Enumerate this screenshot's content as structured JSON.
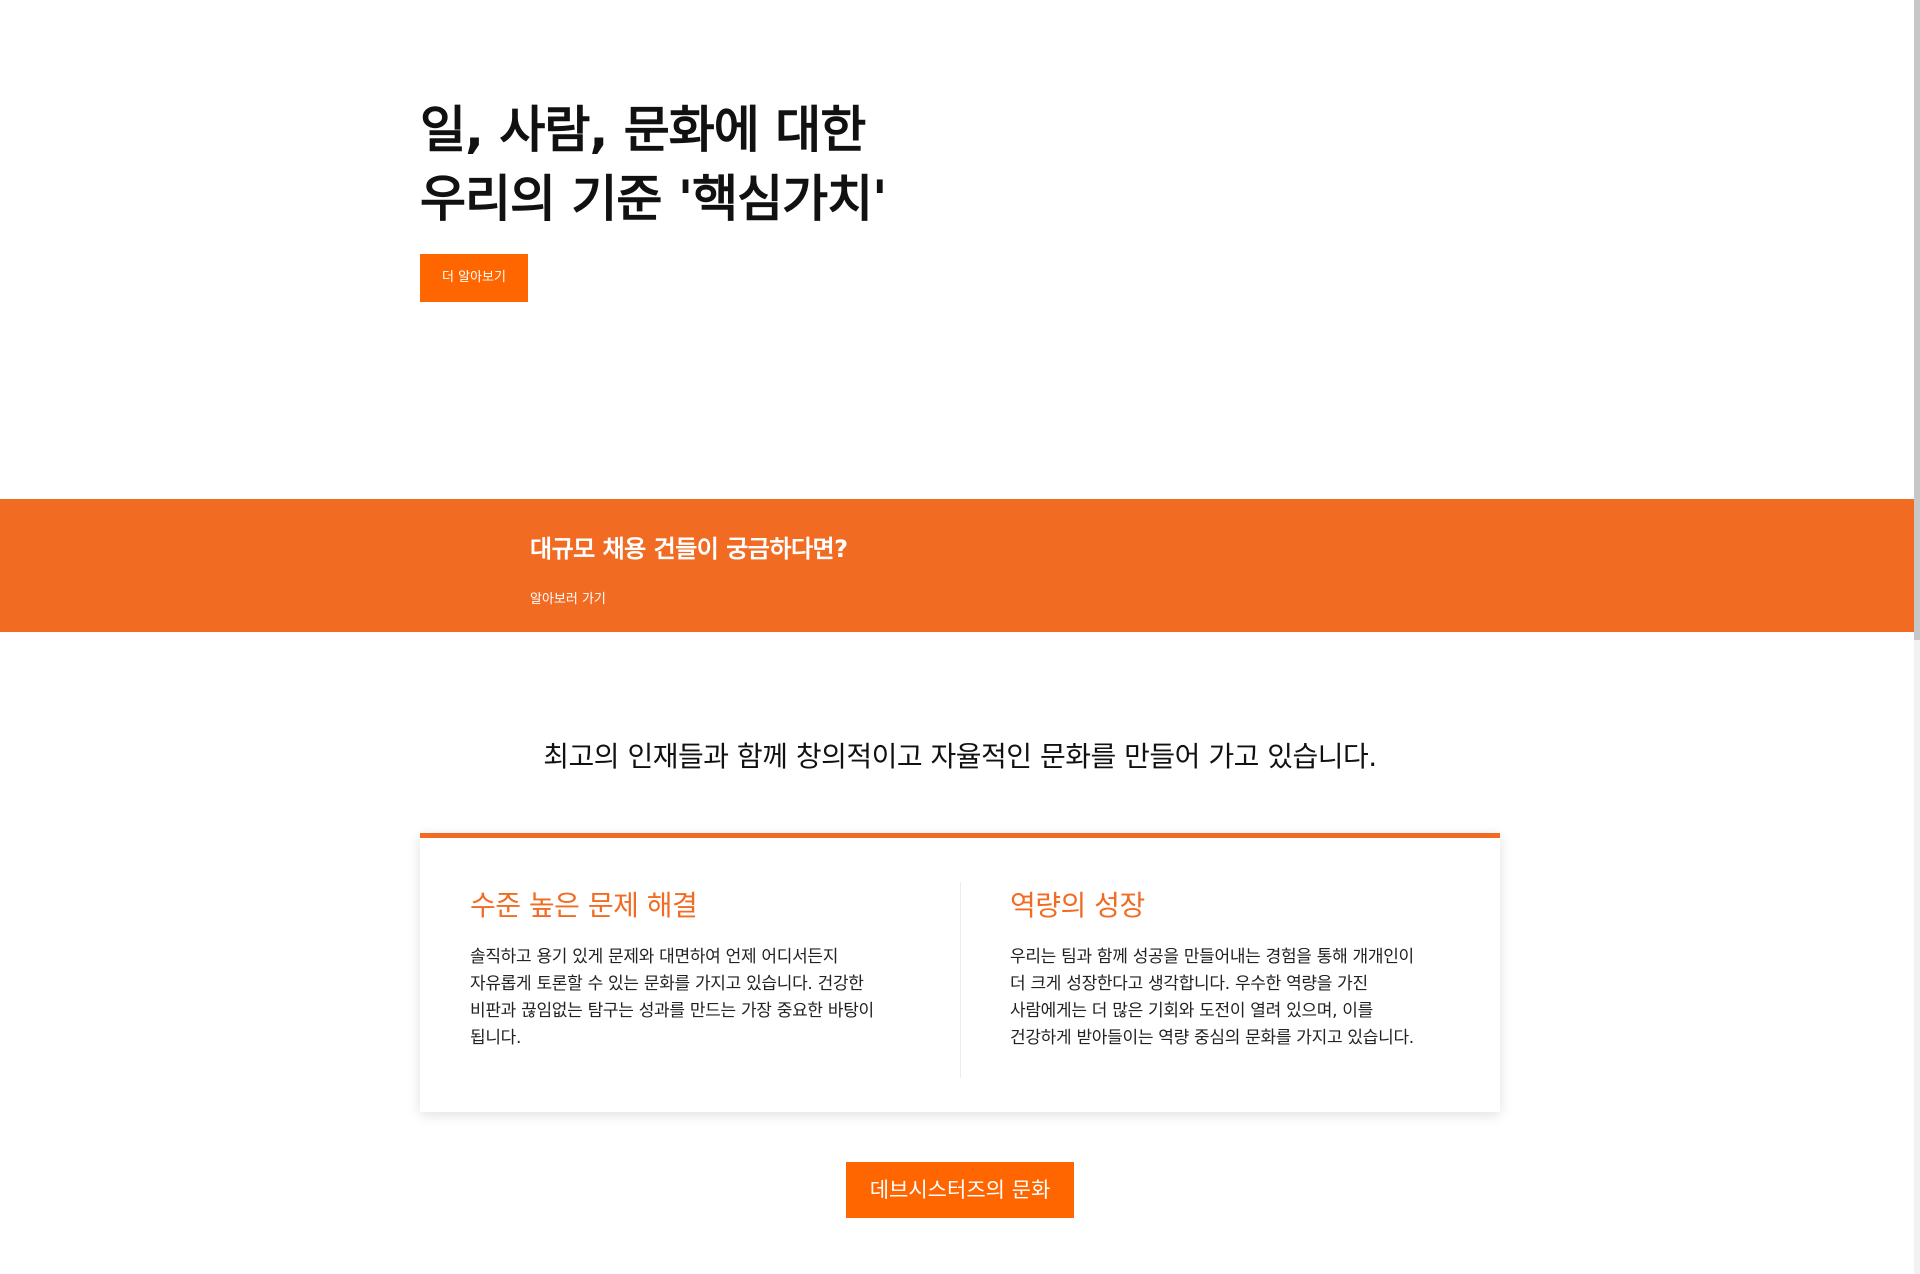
{
  "hero": {
    "title_line1": "일, 사람, 문화에 대한",
    "title_line2": "우리의 기준 '핵심가치'",
    "button_label": "더 알아보기"
  },
  "banner": {
    "title": "대규모 채용 건들이 궁금하다면?",
    "link_label": "알아보러 가기"
  },
  "culture": {
    "heading": "최고의 인재들과 함께 창의적이고 자율적인 문화를 만들어 가고 있습니다.",
    "cards": [
      {
        "title": "수준 높은 문제 해결",
        "lines": [
          "솔직하고 용기 있게 문제와 대면하여 언제 어디서든지",
          "자유롭게 토론할 수 있는 문화를 가지고 있습니다. 건강한",
          "비판과 끊임없는 탐구는 성과를 만드는 가장 중요한 바탕이",
          "됩니다."
        ]
      },
      {
        "title": "역량의 성장",
        "lines": [
          "우리는 팀과 함께 성공을 만들어내는 경험을 통해 개개인이",
          "더 크게 성장한다고 생각합니다. 우수한 역량을 가진",
          "사람에게는 더 많은 기회와 도전이 열려 있으며, 이를",
          "건강하게 받아들이는 역량 중심의 문화를 가지고 있습니다."
        ]
      }
    ],
    "button_label": "데브시스터즈의 문화"
  },
  "colors": {
    "accent": "#f26b23",
    "button": "#ff6600"
  }
}
